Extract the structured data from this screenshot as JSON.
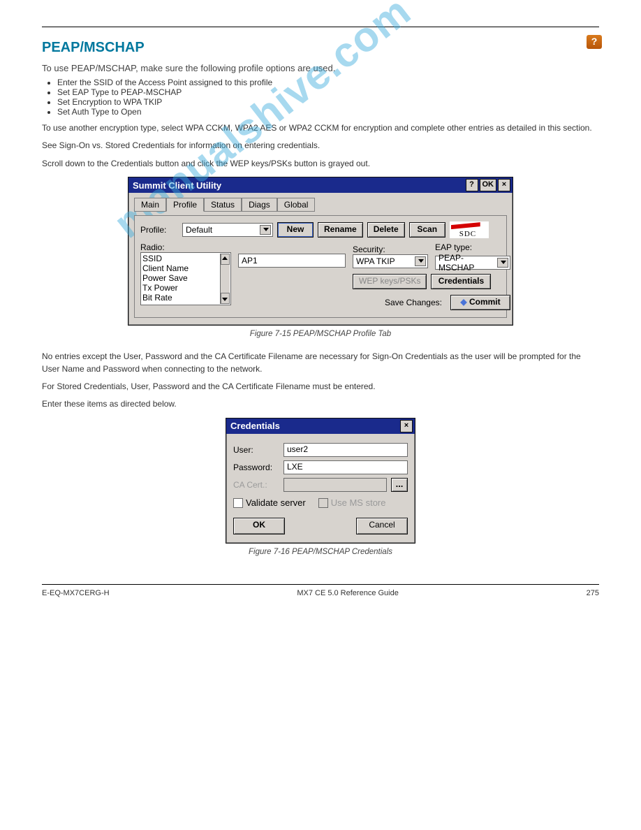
{
  "page": {
    "section_title": "PEAP/MSCHAP",
    "sub_title": "To use PEAP/MSCHAP, make sure the following profile options are used.",
    "bullet_1": "Enter the SSID of the Access Point assigned to this profile",
    "bullet_2": "Set EAP Type to PEAP-MSCHAP",
    "bullet_3": "Set Encryption to WPA TKIP",
    "bullet_4": "Set Auth Type to Open",
    "p_tkip": "To use another encryption type, select WPA CCKM, WPA2 AES or WPA2 CCKM for encryption and complete other entries as detailed in this section.",
    "p_see": "See Sign-On vs. Stored Credentials for information on entering credentials.",
    "p_wep": "Scroll down to the Credentials button and click the WEP keys/PSKs button is grayed out.",
    "p_nocert": "No entries except the User, Password and the CA Certificate Filename are necessary for Sign-On Credentials as the user will be prompted for the User Name and Password when connecting to the network.",
    "p_forstored": "For Stored Credentials, User, Password and the CA Certificate Filename must be entered.",
    "p_enteruser": "Enter these items as directed below.",
    "fig1_caption": "Figure 7-15 PEAP/MSCHAP Profile Tab",
    "fig2_caption": "Figure 7-16 PEAP/MSCHAP Credentials",
    "footer_left": "E-EQ-MX7CERG-H",
    "footer_center": "MX7 CE 5.0 Reference Guide",
    "footer_right": "275"
  },
  "win1": {
    "title": "Summit Client Utility",
    "tb_help": "?",
    "tb_ok": "OK",
    "tb_close": "×",
    "tabs": [
      "Main",
      "Profile",
      "Status",
      "Diags",
      "Global"
    ],
    "profile_label": "Profile:",
    "profile_value": "Default",
    "btn_new": "New",
    "btn_rename": "Rename",
    "btn_delete": "Delete",
    "btn_scan": "Scan",
    "sdc": "SDC",
    "radio_label": "Radio:",
    "radio_items": [
      "SSID",
      "Client Name",
      "Power Save",
      "Tx Power",
      "Bit Rate"
    ],
    "radio_value": "AP1",
    "security_label": "Security:",
    "security_value": "WPA TKIP",
    "eap_label": "EAP type:",
    "eap_value": "PEAP-MSCHAP",
    "btn_wep": "WEP keys/PSKs",
    "btn_cred": "Credentials",
    "save_label": "Save Changes:",
    "btn_commit": "Commit"
  },
  "win2": {
    "title": "Credentials",
    "tb_close": "×",
    "user_label": "User:",
    "user_value": "user2",
    "pass_label": "Password:",
    "pass_value": "LXE",
    "ca_label": "CA Cert.:",
    "dots": "...",
    "validate": "Validate server",
    "msstore": "Use MS store",
    "btn_ok": "OK",
    "btn_cancel": "Cancel"
  }
}
